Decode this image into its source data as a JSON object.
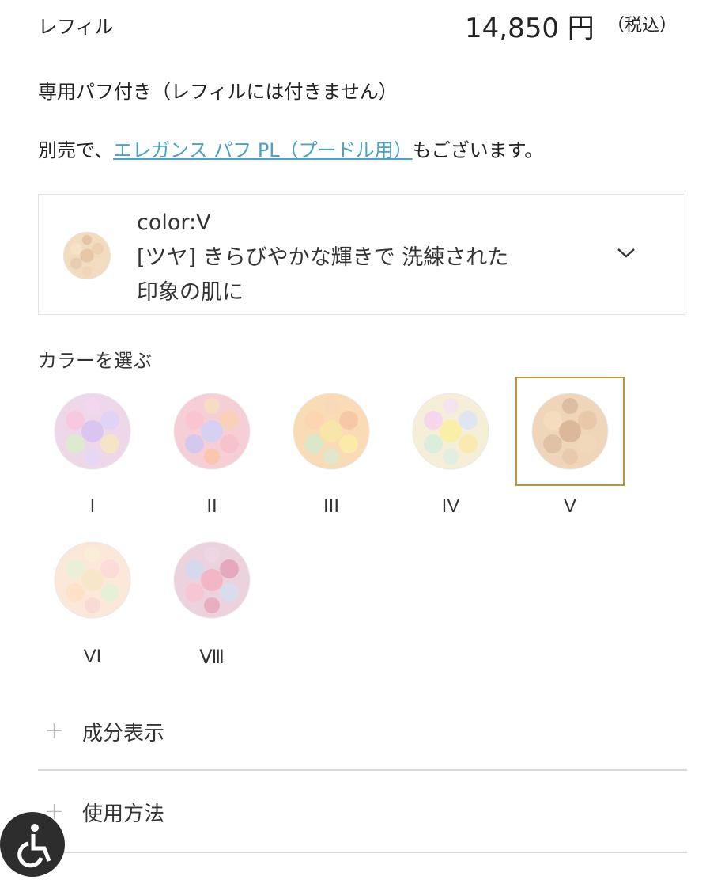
{
  "product": {
    "variant_label": "レフィル",
    "price": "14,850 円",
    "tax_note": "（税込）",
    "puff_note": "専用パフ付き（レフィルには付きません）",
    "separate_prefix": "別売で、",
    "separate_link": "エレガンス パフ PL（プードル用）",
    "separate_suffix": "もございます。"
  },
  "selector": {
    "color_line": "color:V",
    "desc_line1": "[ツヤ] きらびやかな輝きで 洗練された",
    "desc_line2": "印象の肌に"
  },
  "choose": {
    "label": "カラーを選ぶ",
    "options": [
      {
        "label": "I"
      },
      {
        "label": "II"
      },
      {
        "label": "III"
      },
      {
        "label": "IV"
      },
      {
        "label": "V",
        "selected": true
      },
      {
        "label": "VI"
      },
      {
        "label": "Ⅷ"
      }
    ]
  },
  "accordion": {
    "ingredients": "成分表示",
    "usage": "使用方法"
  },
  "colors": {
    "link": "#4aa3c7",
    "selected_border": "#b8963a",
    "divider": "#d8d8d8"
  }
}
